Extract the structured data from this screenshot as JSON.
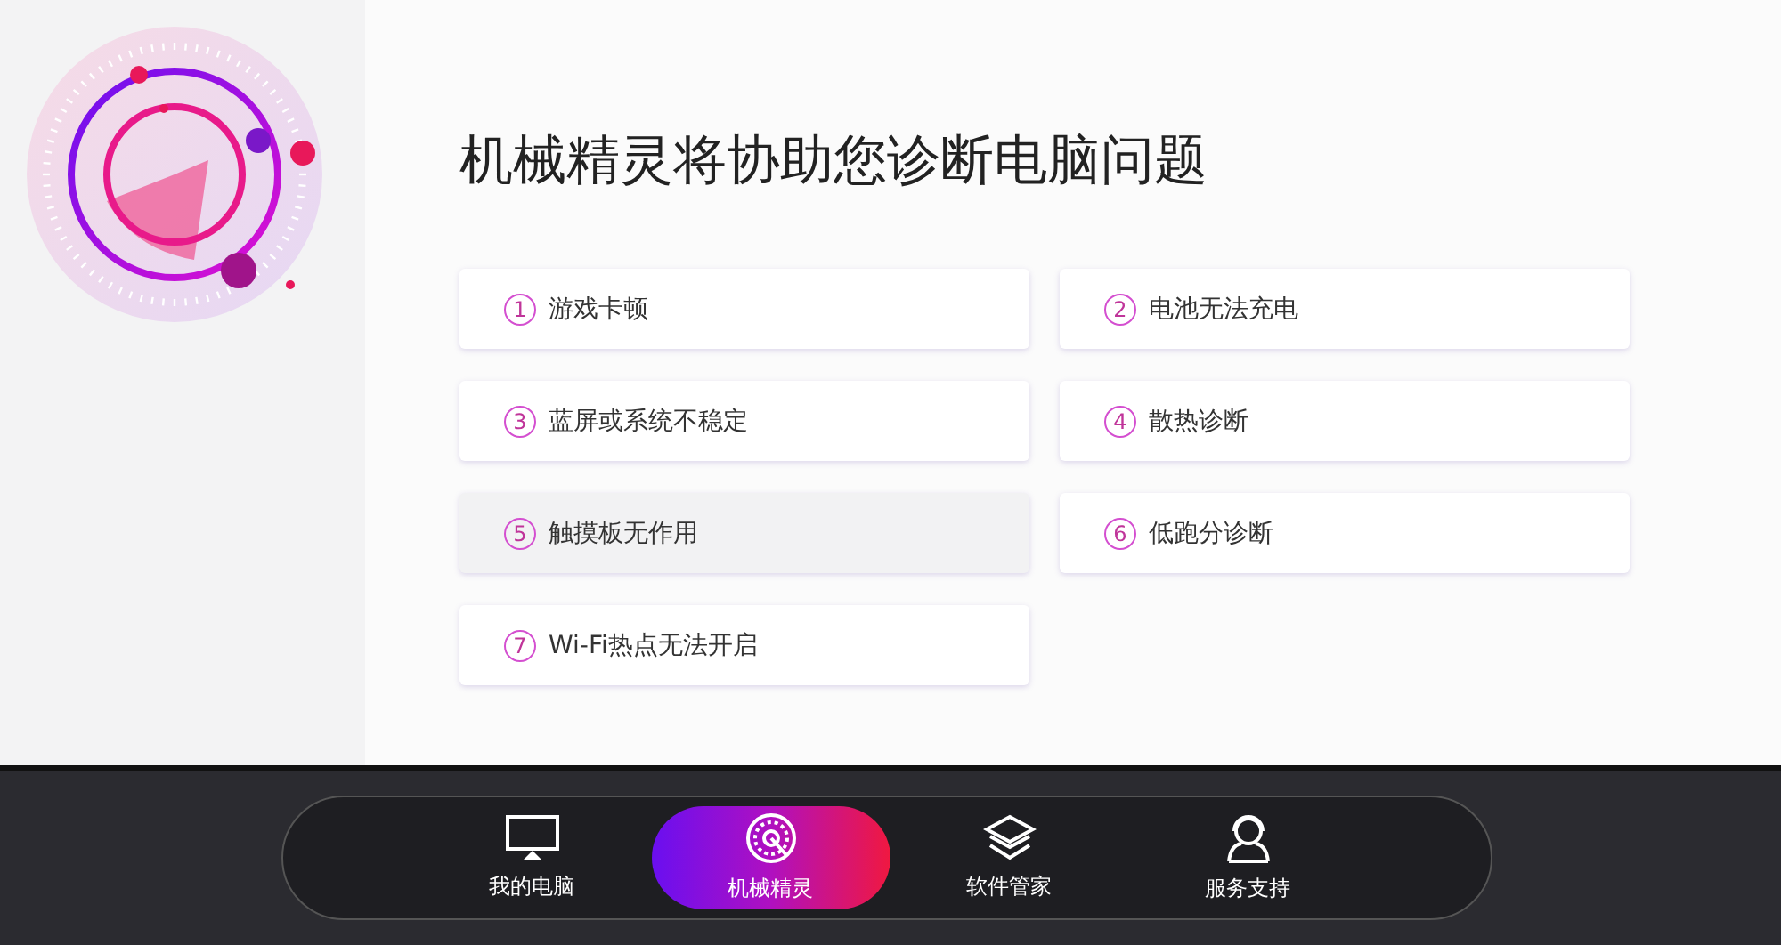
{
  "heading": "机械精灵将协助您诊断电脑问题",
  "problems": [
    {
      "number": "1",
      "label": "游戏卡顿",
      "hovered": false
    },
    {
      "number": "2",
      "label": "电池无法充电",
      "hovered": false
    },
    {
      "number": "3",
      "label": "蓝屏或系统不稳定",
      "hovered": false
    },
    {
      "number": "4",
      "label": "散热诊断",
      "hovered": false
    },
    {
      "number": "5",
      "label": "触摸板无作用",
      "hovered": true
    },
    {
      "number": "6",
      "label": "低跑分诊断",
      "hovered": false
    },
    {
      "number": "7",
      "label": "Wi-Fi热点无法开启",
      "hovered": false
    }
  ],
  "nav": [
    {
      "kind": "monitor",
      "label": "我的电脑",
      "selected": false
    },
    {
      "kind": "radar",
      "label": "机械精灵",
      "selected": true
    },
    {
      "kind": "layers",
      "label": "软件管家",
      "selected": false
    },
    {
      "kind": "support",
      "label": "服务支持",
      "selected": false
    }
  ]
}
